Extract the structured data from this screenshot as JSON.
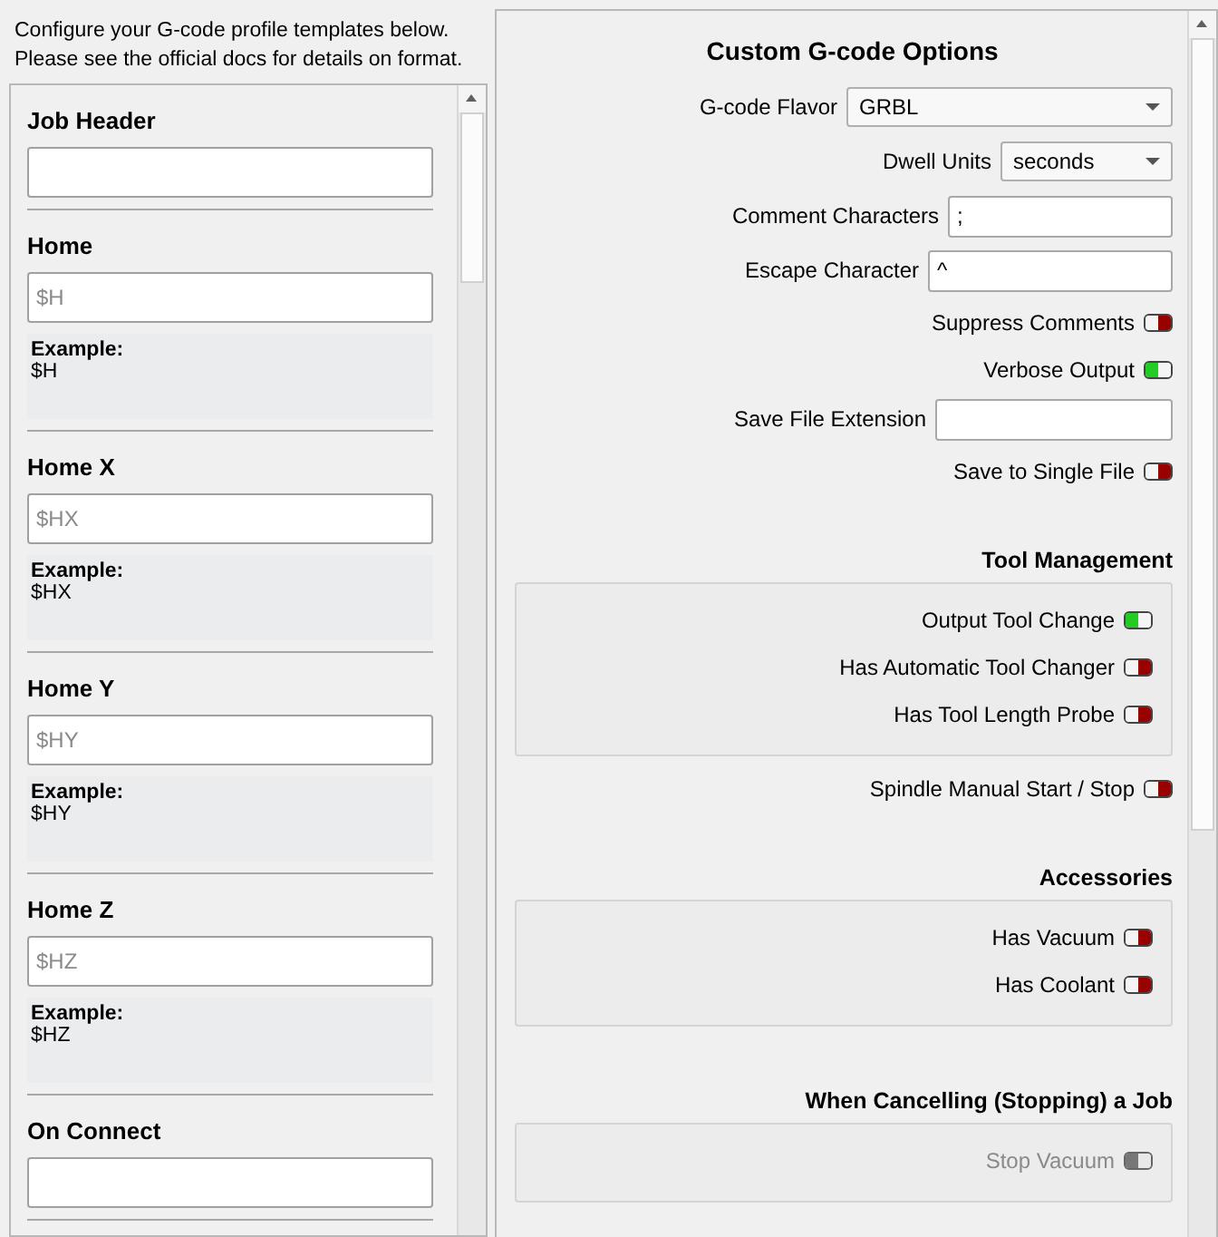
{
  "intro": [
    "Configure your G-code profile templates below.",
    "Please see the official docs for details on format."
  ],
  "templates": [
    {
      "title": "Job Header"
    },
    {
      "title": "Home",
      "placeholder": "$H",
      "example_label": "Example:",
      "example": "$H"
    },
    {
      "title": "Home X",
      "placeholder": "$HX",
      "example_label": "Example:",
      "example": "$HX"
    },
    {
      "title": "Home Y",
      "placeholder": "$HY",
      "example_label": "Example:",
      "example": "$HY"
    },
    {
      "title": "Home Z",
      "placeholder": "$HZ",
      "example_label": "Example:",
      "example": "$HZ"
    },
    {
      "title": "On Connect"
    }
  ],
  "options": {
    "title": "Custom G-code Options",
    "items": [
      {
        "kind": "select",
        "label": "G-code Flavor",
        "value": "GRBL"
      },
      {
        "kind": "select",
        "label": "Dwell Units",
        "value": "seconds"
      },
      {
        "kind": "input",
        "label": "Comment Characters",
        "value": ";"
      },
      {
        "kind": "input",
        "label": "Escape Character",
        "value": "^"
      },
      {
        "kind": "toggle",
        "label": "Suppress Comments",
        "on": false
      },
      {
        "kind": "toggle",
        "label": "Verbose Output",
        "on": true
      },
      {
        "kind": "input",
        "label": "Save File Extension"
      },
      {
        "kind": "toggle",
        "label": "Save to Single File",
        "on": false
      },
      {
        "kind": "group",
        "title": "Tool Management",
        "items": [
          {
            "kind": "toggle",
            "label": "Output Tool Change",
            "on": true
          },
          {
            "kind": "toggle",
            "label": "Has Automatic Tool Changer",
            "on": false
          },
          {
            "kind": "toggle",
            "label": "Has Tool Length Probe",
            "on": false
          }
        ]
      },
      {
        "kind": "toggle",
        "label": "Spindle Manual Start / Stop",
        "on": false
      },
      {
        "kind": "group",
        "title": "Accessories",
        "items": [
          {
            "kind": "toggle",
            "label": "Has Vacuum",
            "on": false
          },
          {
            "kind": "toggle",
            "label": "Has Coolant",
            "on": false
          }
        ]
      },
      {
        "kind": "group",
        "title": "When Cancelling (Stopping) a Job",
        "items": [
          {
            "kind": "toggle",
            "label": "Stop Vacuum",
            "on": false,
            "disabled": true
          }
        ]
      }
    ]
  }
}
